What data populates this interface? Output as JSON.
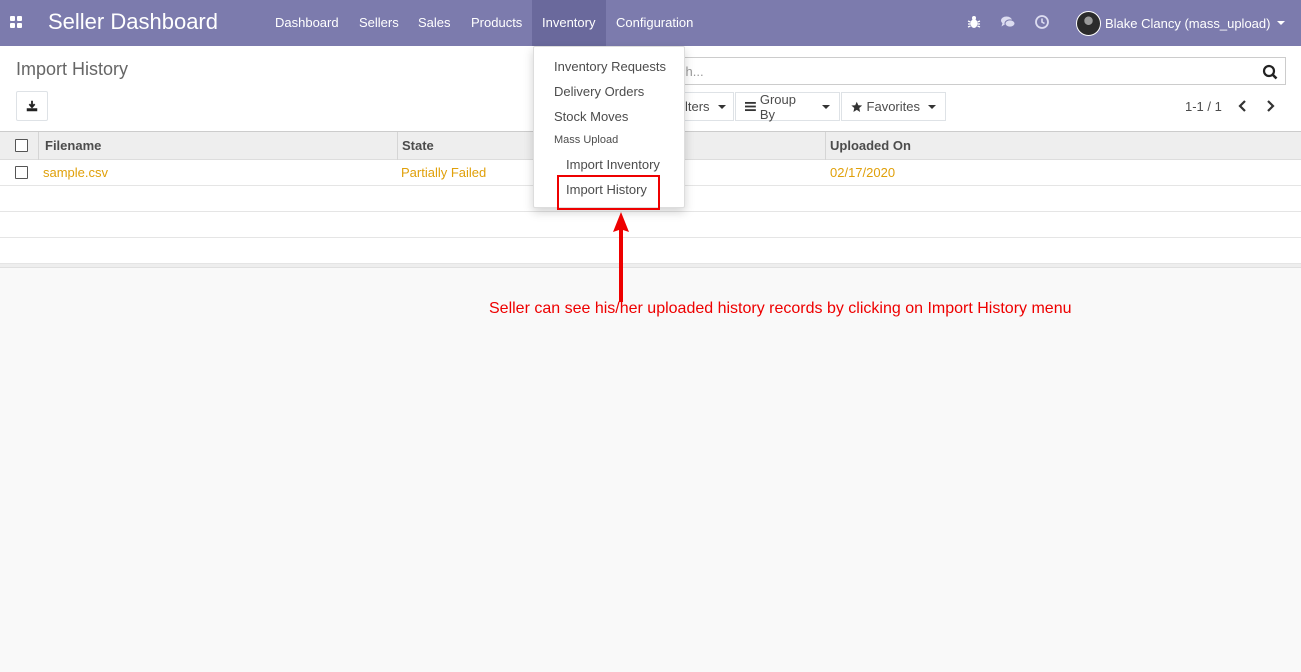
{
  "navbar": {
    "brand": "Seller Dashboard",
    "menu": [
      "Dashboard",
      "Sellers",
      "Sales",
      "Products",
      "Inventory",
      "Configuration"
    ],
    "active_menu": "Inventory",
    "user_name": "Blake Clancy (mass_upload)",
    "icons": [
      "apps-icon",
      "bug-icon",
      "chat-icon",
      "clock-icon",
      "avatar"
    ]
  },
  "control": {
    "title": "Import History",
    "search_placeholder": "ch...",
    "filters_label": "lters",
    "groupby_label": "Group By",
    "favorites_label": "Favorites",
    "pager": "1-1 / 1"
  },
  "table": {
    "headers": [
      "Filename",
      "State",
      "Uploaded On"
    ],
    "rows": [
      {
        "filename": "sample.csv",
        "state": "Partially Failed",
        "uploaded_on": "02/17/2020"
      }
    ]
  },
  "dropdown": {
    "items": [
      "Inventory Requests",
      "Delivery Orders",
      "Stock Moves"
    ],
    "section_header": "Mass Upload",
    "sub_items": [
      "Import Inventory",
      "Import History"
    ],
    "highlighted": "Import History"
  },
  "annotation": {
    "text": "Seller can see his/her uploaded history records by clicking on Import History menu",
    "color": "#e00000"
  },
  "colors": {
    "navbar": "#7c7bad",
    "link": "#e0a00a"
  }
}
